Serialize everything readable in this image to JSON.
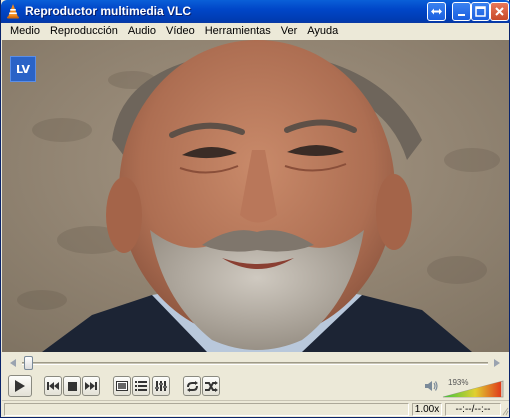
{
  "window": {
    "title": "Reproductor multimedia VLC"
  },
  "menu": [
    "Medio",
    "Reproducción",
    "Audio",
    "Vídeo",
    "Herramientas",
    "Ver",
    "Ayuda"
  ],
  "video": {
    "channel_logo": "LV"
  },
  "controls": {
    "volume_percent": "193%",
    "volume_level": 0.97,
    "seek_position": 0.0
  },
  "status": {
    "rate": "1.00x",
    "time": "--:--/--:--"
  },
  "colors": {
    "titlebar": "#0046c8",
    "accent": "#2a63c7"
  },
  "icons": [
    "vlc-cone-icon",
    "aspect-icon",
    "minimize-icon",
    "maximize-icon",
    "close-icon",
    "play-icon",
    "previous-icon",
    "stop-icon",
    "next-icon",
    "fullscreen-icon",
    "playlist-icon",
    "extended-settings-icon",
    "loop-icon",
    "shuffle-icon",
    "speaker-icon"
  ]
}
